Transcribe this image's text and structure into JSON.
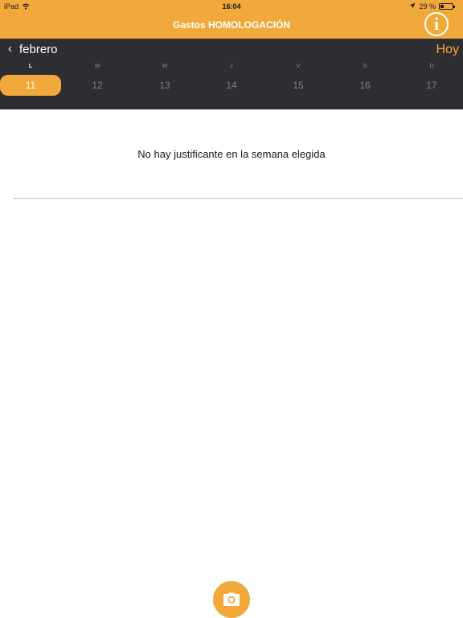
{
  "status_bar": {
    "device": "iPad",
    "time": "16:04",
    "battery": "29 %",
    "battery_level": 0.29,
    "icons": [
      "wifi-icon",
      "location-arrow-icon",
      "battery-icon"
    ]
  },
  "nav": {
    "title": "Gastos HOMOLOGACIÓN",
    "info_label": "i",
    "accent_color": "#F2A93B"
  },
  "calendar": {
    "back_chevron": "‹",
    "month": "febrero",
    "today_label": "Hoy",
    "weekdays": [
      "L",
      "M",
      "M",
      "J",
      "V",
      "S",
      "D"
    ],
    "days": [
      "11",
      "12",
      "13",
      "14",
      "15",
      "16",
      "17"
    ],
    "selected_index": 0,
    "background_color": "#2E2D31"
  },
  "content": {
    "empty_message": "No hay justificante en la semana elegida"
  },
  "footer": {
    "camera_icon": "camera-icon"
  }
}
